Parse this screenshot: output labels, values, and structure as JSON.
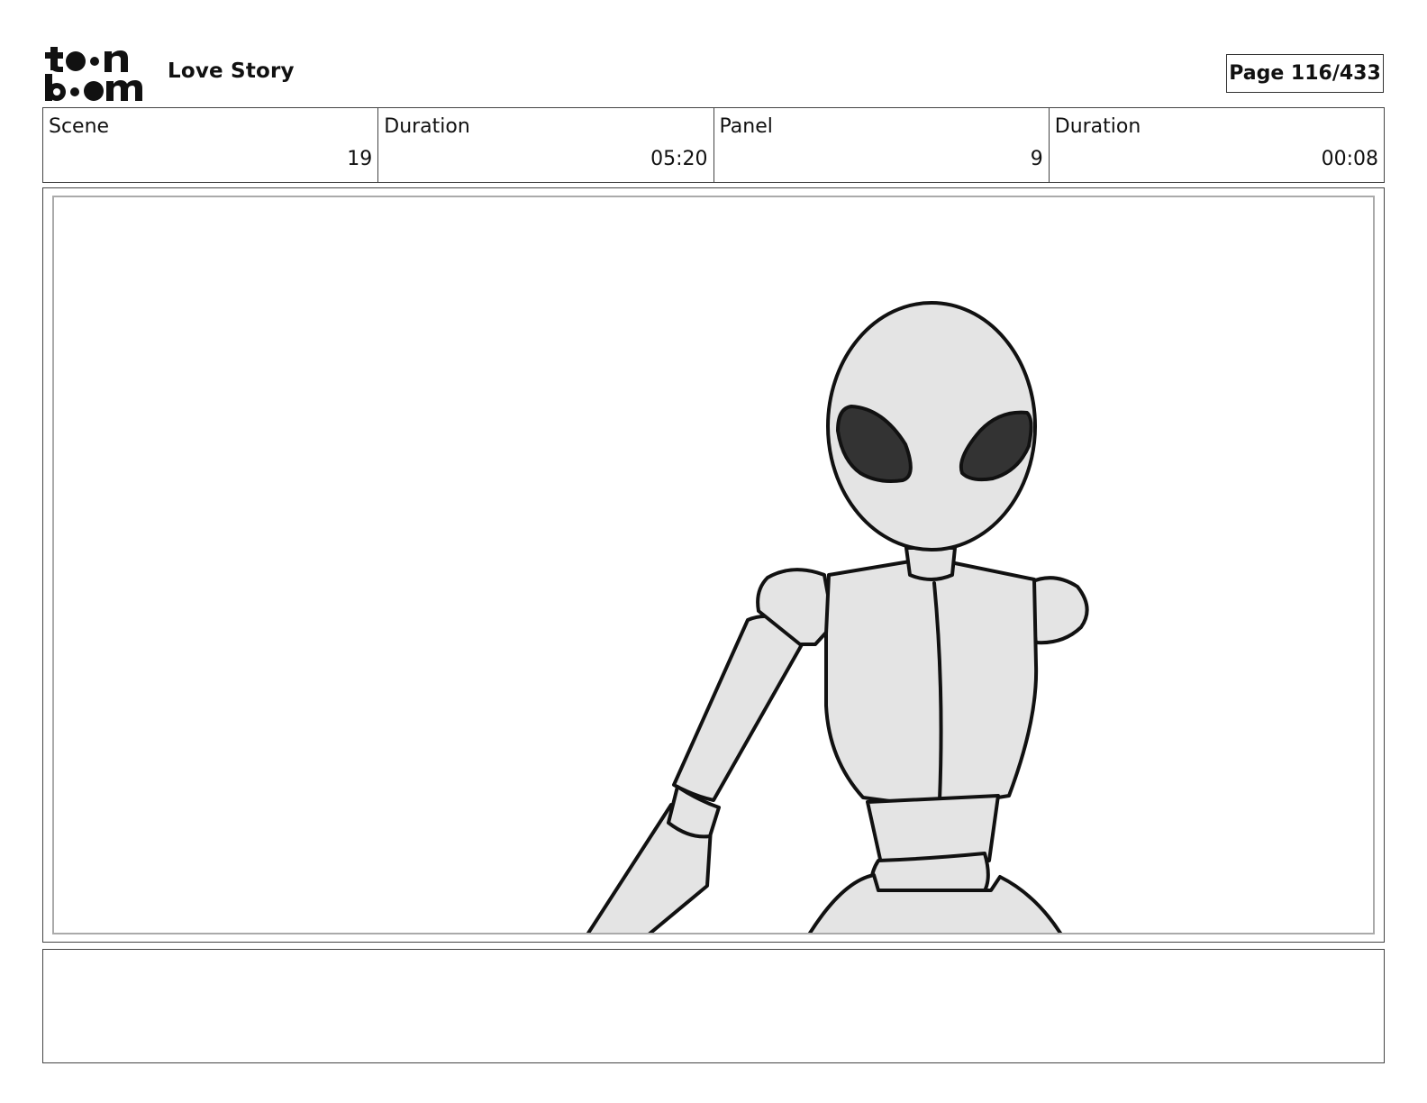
{
  "header": {
    "project_title": "Love Story",
    "page_label": "Page 116/433"
  },
  "info": {
    "scene_label": "Scene",
    "scene_value": "19",
    "scene_duration_label": "Duration",
    "scene_duration_value": "05:20",
    "panel_label": "Panel",
    "panel_value": "9",
    "panel_duration_label": "Duration",
    "panel_duration_value": "00:08"
  },
  "colors": {
    "figure_fill": "#e4e4e4",
    "eye_fill": "#333333",
    "line": "#111111"
  }
}
